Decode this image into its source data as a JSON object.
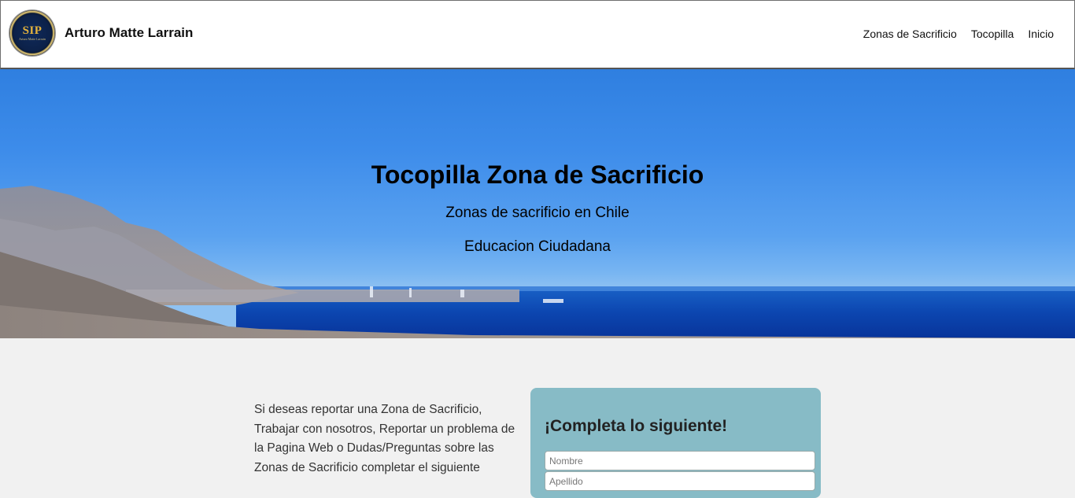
{
  "nav": {
    "logo": {
      "initials": "SIP",
      "subtitle": "Arturo Matte Larrain"
    },
    "brand": "Arturo Matte Larrain",
    "links": [
      "Zonas de Sacrificio",
      "Tocopilla",
      "Inicio"
    ]
  },
  "hero": {
    "title": "Tocopilla Zona de Sacrificio",
    "subtitle1": "Zonas de sacrificio en Chile",
    "subtitle2": "Educacion Ciudadana"
  },
  "intro": {
    "text": "Si deseas reportar una Zona de Sacrificio, Trabajar con nosotros, Reportar un problema de la Pagina Web o Dudas/Preguntas sobre las Zonas de Sacrificio completar el siguiente"
  },
  "form": {
    "title": "¡Completa lo siguiente!",
    "fields": [
      {
        "placeholder": "Nombre",
        "value": ""
      },
      {
        "placeholder": "Apellido",
        "value": ""
      }
    ]
  },
  "colors": {
    "form_card": "#87bbc6",
    "background": "#f1f1f1",
    "sky": "#3d8cea",
    "sea": "#0a3fa0"
  }
}
